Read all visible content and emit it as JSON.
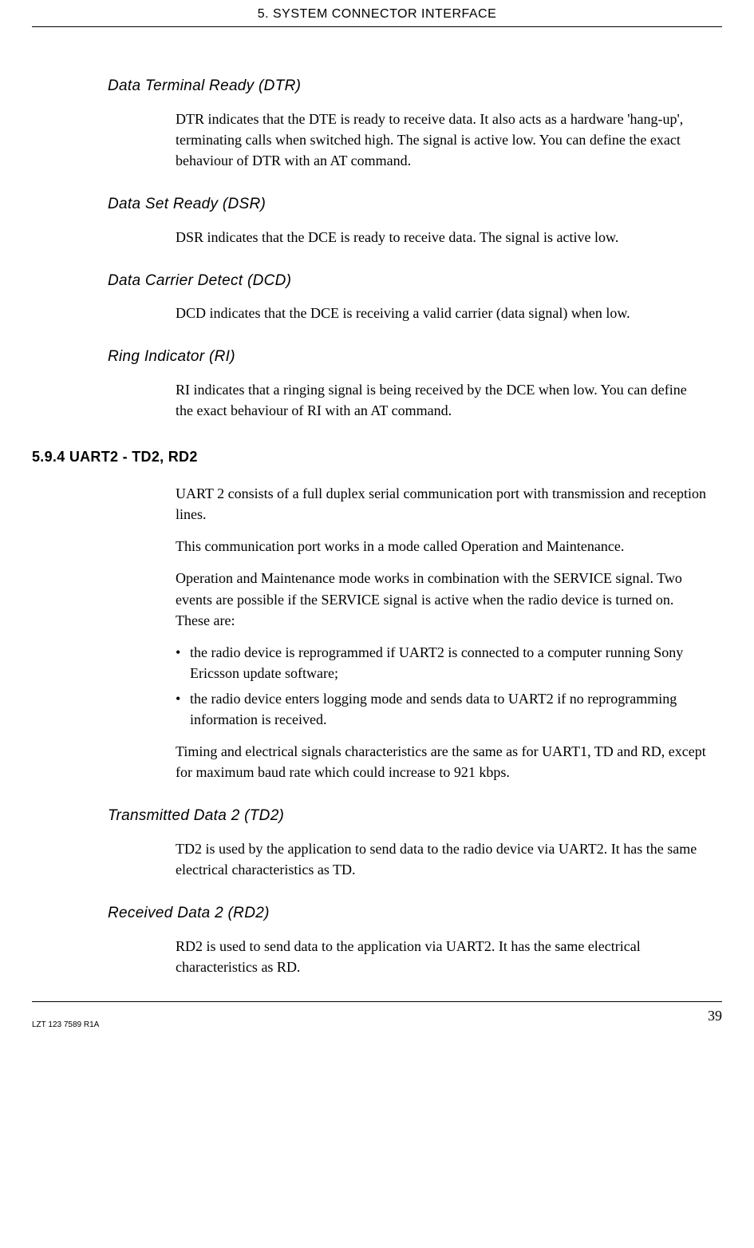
{
  "header": "5. SYSTEM CONNECTOR INTERFACE",
  "sections": {
    "dtr": {
      "title": "Data Terminal Ready (DTR)",
      "body": "DTR indicates that the DTE is ready to receive data. It also acts as a hardware 'hang-up', terminating calls when switched high. The signal is active low. You can define the exact behaviour of DTR with an AT command."
    },
    "dsr": {
      "title": "Data Set Ready (DSR)",
      "body": "DSR indicates that the DCE is ready to receive data. The signal is active low."
    },
    "dcd": {
      "title": "Data Carrier Detect (DCD)",
      "body": "DCD indicates that the DCE is receiving a valid carrier (data signal) when low."
    },
    "ri": {
      "title": "Ring Indicator (RI)",
      "body": "RI indicates that a ringing signal is being received by the DCE when low. You can define the exact behaviour of RI with an AT command."
    },
    "uart2": {
      "title": "5.9.4 UART2 - TD2, RD2",
      "p1": "UART 2 consists of a full duplex serial communication port with transmission and reception lines.",
      "p2": "This communication port works in a mode called Operation and Maintenance.",
      "p3": "Operation and Maintenance mode works in combination with the SERVICE signal. Two events are possible if the SERVICE signal is active when the radio device is turned on. These are:",
      "bullets": [
        "the radio device is reprogrammed if UART2 is connected to a computer running Sony Ericsson update software;",
        "the radio device enters logging mode and sends data to UART2 if no reprogramming information is received."
      ],
      "p4": "Timing and electrical signals characteristics are the same as for UART1, TD and RD, except for maximum baud rate which could increase to 921 kbps."
    },
    "td2": {
      "title": "Transmitted Data 2 (TD2)",
      "body": "TD2 is used by the application to send data to the radio device via UART2. It has the same electrical characteristics as TD."
    },
    "rd2": {
      "title": "Received Data 2 (RD2)",
      "body": "RD2 is used to send data to the application via UART2. It has the same electrical characteristics as RD."
    }
  },
  "footer": {
    "doc_id": "LZT 123 7589 R1A",
    "page_number": "39"
  }
}
